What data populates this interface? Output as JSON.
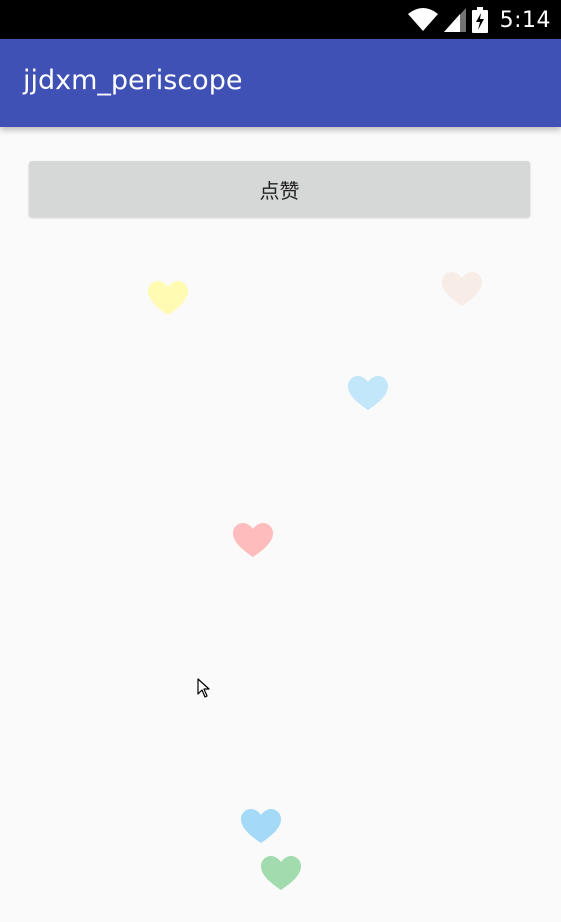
{
  "status_bar": {
    "time": "5:14",
    "icons": [
      "wifi-icon",
      "cell-signal-icon",
      "battery-charging-icon"
    ]
  },
  "app_bar": {
    "title": "jjdxm_periscope",
    "color": "#3f51b5"
  },
  "main": {
    "like_button_label": "点赞",
    "hearts": [
      {
        "name": "heart-yellow",
        "color": "#fffbb3"
      },
      {
        "name": "heart-beige",
        "color": "#f7ede6"
      },
      {
        "name": "heart-light-blue",
        "color": "#c2e7fa"
      },
      {
        "name": "heart-pink",
        "color": "#ffbcbc"
      },
      {
        "name": "heart-blue",
        "color": "#a4daf8"
      },
      {
        "name": "heart-green",
        "color": "#a2dcae"
      }
    ]
  }
}
